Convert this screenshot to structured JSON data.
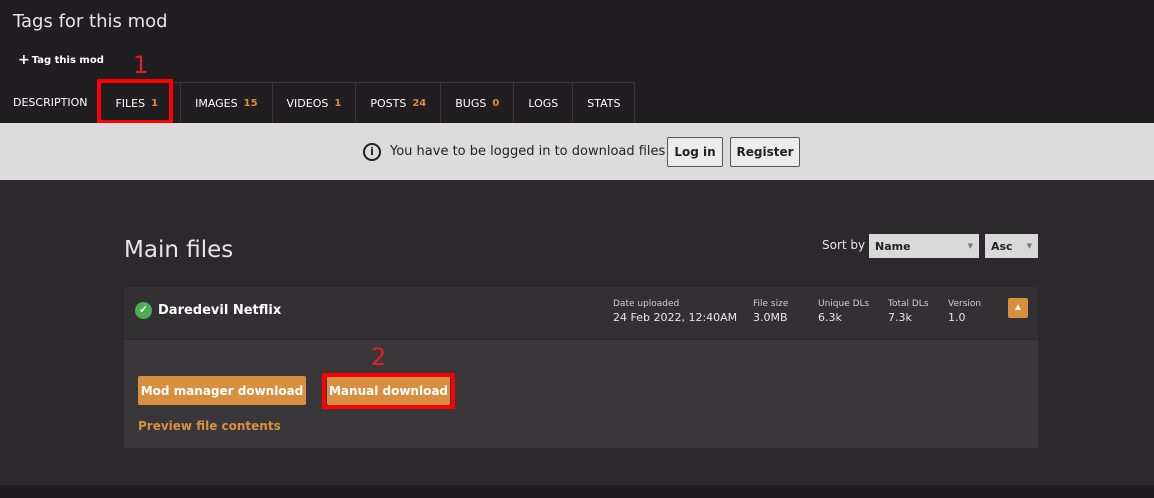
{
  "header": {
    "title": "Tags for this mod",
    "tag_button": "Tag this mod"
  },
  "annotations": {
    "first": "1",
    "second": "2"
  },
  "tabs": [
    {
      "label": "DESCRIPTION",
      "count": ""
    },
    {
      "label": "FILES",
      "count": "1"
    },
    {
      "label": "IMAGES",
      "count": "15"
    },
    {
      "label": "VIDEOS",
      "count": "1"
    },
    {
      "label": "POSTS",
      "count": "24"
    },
    {
      "label": "BUGS",
      "count": "0"
    },
    {
      "label": "LOGS",
      "count": ""
    },
    {
      "label": "STATS",
      "count": ""
    }
  ],
  "login_bar": {
    "message": "You have to be logged in to download files",
    "login": "Log in",
    "register": "Register"
  },
  "main": {
    "title": "Main files",
    "sort_label": "Sort by",
    "sort_field": "Name",
    "sort_order": "Asc"
  },
  "file": {
    "name": "Daredevil Netflix",
    "stats": {
      "date_label": "Date uploaded",
      "date_value": "24 Feb 2022, 12:40AM",
      "size_label": "File size",
      "size_value": "3.0MB",
      "unique_label": "Unique DLs",
      "unique_value": "6.3k",
      "total_label": "Total DLs",
      "total_value": "7.3k",
      "version_label": "Version",
      "version_value": "1.0"
    },
    "mod_manager_button": "Mod manager download",
    "manual_button": "Manual download",
    "preview_link": "Preview file contents"
  },
  "colors": {
    "accent": "#d98f40",
    "highlight": "#ff0000"
  }
}
